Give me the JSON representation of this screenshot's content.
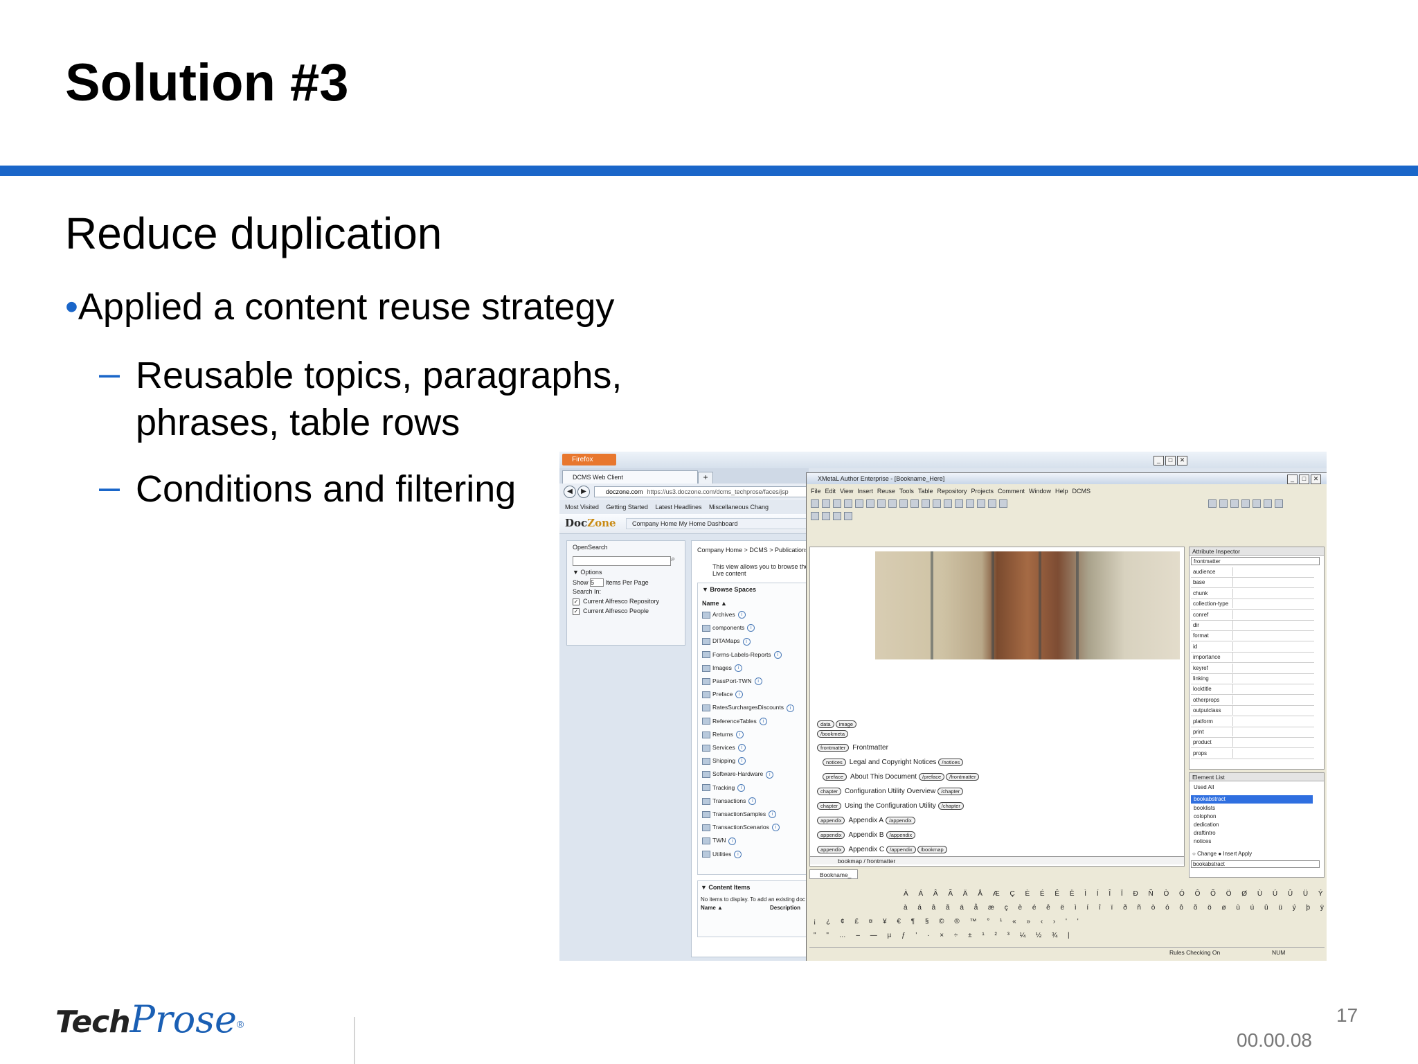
{
  "slide": {
    "title": "Solution #3",
    "subheading": "Reduce duplication",
    "bullet": "Applied a content reuse strategy",
    "bullet_marker": "•",
    "dash": "–",
    "sub_bullets": [
      "Reusable topics, paragraphs,",
      "phrases, table rows",
      "Conditions and filtering"
    ],
    "page_number": "17",
    "timecode": "00.00.08",
    "logo_text_1": "Tech",
    "logo_text_2": "Prose",
    "logo_reg": "®",
    "accent_color": "#1a66c9"
  },
  "browser": {
    "app_button": "Firefox",
    "tab_title": "DCMS Web Client",
    "new_tab": "+",
    "url_domain": "doczone.com",
    "url_rest": "https://us3.doczone.com/dcms_techprose/faces/jsp",
    "bookmarks": [
      "Most Visited",
      "Getting Started",
      "Latest Headlines",
      "Miscellaneous Chang"
    ],
    "window_buttons": [
      "_",
      "□",
      "✕"
    ]
  },
  "doczone": {
    "logo_prefix": "Doc",
    "logo_suffix": "Zone",
    "nav": "Company Home  My Home  Dashboard",
    "opensearch": "OpenSearch",
    "options": "Options",
    "show_label": "Show",
    "show_value": "5",
    "items_per_page": "Items Per Page",
    "search_in": "Search In:",
    "search_targets": [
      "Current Alfresco Repository",
      "Current Alfresco People"
    ],
    "breadcrumb": "Company Home  >  DCMS  >  Publications  >",
    "view_note_1": "This view allows you to browse the i",
    "view_note_2": "Live content",
    "browse_spaces": "Browse Spaces",
    "name_col": "Name ▲",
    "spaces": [
      "Archives",
      "components",
      "DITAMaps",
      "Forms-Labels-Reports",
      "Images",
      "PassPort-TWN",
      "Preface",
      "RatesSurchargesDiscounts",
      "ReferenceTables",
      "Returns",
      "Services",
      "Shipping",
      "Software-Hardware",
      "Tracking",
      "Transactions",
      "TransactionSamples",
      "TransactionScenarios",
      "TWN",
      "Utilities"
    ],
    "content_items": "Content Items",
    "no_items": "No items to display. To add an existing doc",
    "content_cols": [
      "Name ▲",
      "Description"
    ]
  },
  "xmetal": {
    "title": "XMetaL Author Enterprise - [Bookname_Here]",
    "menu": [
      "File",
      "Edit",
      "View",
      "Insert",
      "Reuse",
      "Tools",
      "Table",
      "Repository",
      "Projects",
      "Comment",
      "Window",
      "Help",
      "DCMS"
    ],
    "tags_top": [
      "data",
      "image"
    ],
    "tag_bookmeta": "/bookmeta",
    "structure": [
      {
        "open": "frontmatter",
        "text": "Frontmatter",
        "close": []
      },
      {
        "open": "notices",
        "text": "Legal and Copyright Notices",
        "close": [
          "/notices"
        ]
      },
      {
        "open": "preface",
        "text": "About This Document",
        "close": [
          "/preface",
          "/frontmatter"
        ]
      },
      {
        "open": "chapter",
        "text": "Configuration Utility Overview",
        "close": [
          "/chapter"
        ]
      },
      {
        "open": "chapter",
        "text": "Using the Configuration Utility",
        "close": [
          "/chapter"
        ]
      },
      {
        "open": "appendix",
        "text": "Appendix A",
        "close": [
          "/appendix"
        ]
      },
      {
        "open": "appendix",
        "text": "Appendix B",
        "close": [
          "/appendix"
        ]
      },
      {
        "open": "appendix",
        "text": "Appendix C",
        "close": [
          "/appendix",
          "/bookmap"
        ]
      }
    ],
    "path": "bookmap / frontmatter",
    "doc_tab": "Bookname_",
    "attribute_inspector": "Attribute Inspector",
    "attribute_select": "frontmatter",
    "attributes": [
      "audience",
      "base",
      "chunk",
      "collection-type",
      "conref",
      "dir",
      "format",
      "id",
      "importance",
      "keyref",
      "linking",
      "locktitle",
      "otherprops",
      "outputclass",
      "platform",
      "print",
      "product",
      "props"
    ],
    "element_list": "Element List",
    "el_tabs": [
      "Used",
      "All"
    ],
    "elements_selected": "bookabstract",
    "elements": [
      "booklists",
      "colophon",
      "dedication",
      "draftintro",
      "notices"
    ],
    "el_change": "Change",
    "el_insert": "Insert",
    "el_apply": "Apply",
    "el_current": "bookabstract",
    "charmap": [
      "À Á Â Ã Ä Å Æ Ç È É Ê Ë Ì Í Î Ï Ð Ñ Ò Ó Ô Õ Ö Ø Ù Ú Û Ü Ý Þ ß",
      "à á â ã ä å æ ç è é ê ë ì í î ï ð ñ ò ó ô õ ö ø ù ú û ü ý þ ÿ",
      "¡ ¿ ¢ £ ¤ ¥ € ¶ § © ® ™ ° ¹ « » ‹ › ' '",
      "\" \" … – — µ ƒ ' · × ÷ ± ¹ ² ³ ¼ ½ ¾ |"
    ],
    "status_rules": "Rules Checking On",
    "status_num": "NUM"
  }
}
